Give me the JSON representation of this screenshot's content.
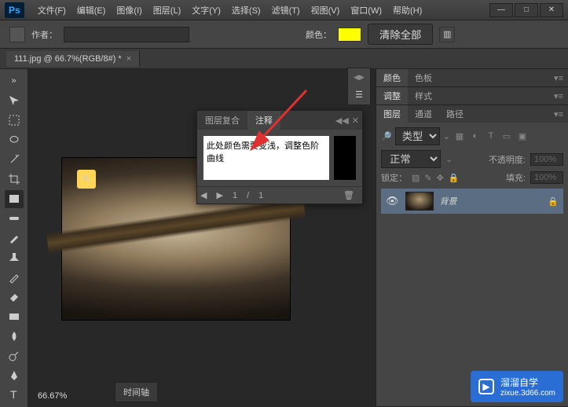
{
  "menubar": {
    "items": [
      "文件(F)",
      "编辑(E)",
      "图像(I)",
      "图层(L)",
      "文字(Y)",
      "选择(S)",
      "滤镜(T)",
      "视图(V)",
      "窗口(W)",
      "帮助(H)"
    ]
  },
  "window_controls": {
    "min": "—",
    "max": "□",
    "close": "✕"
  },
  "options": {
    "author_label": "作者：",
    "author_value": "",
    "color_label": "颜色：",
    "color_value": "#ffff00",
    "clear_all": "清除全部"
  },
  "doc_tab": {
    "title": "111.jpg @ 66.7%(RGB/8#) *"
  },
  "notes_panel": {
    "tabs": [
      "图层复合",
      "注释"
    ],
    "text": "此处颜色需要变浅，调整色阶曲线",
    "page_current": "1",
    "page_sep": "/",
    "page_total": "1"
  },
  "zoom": "66.67%",
  "timeline": "时间轴",
  "right": {
    "color_tabs": [
      "颜色",
      "色板"
    ],
    "adjust_tabs": [
      "调整",
      "样式"
    ],
    "layer_tabs": [
      "图层",
      "通道",
      "路径"
    ],
    "filter_label": "类型",
    "blend_mode": "正常",
    "opacity_label": "不透明度:",
    "opacity_value": "100%",
    "lock_label": "锁定：",
    "fill_label": "填充:",
    "fill_value": "100%",
    "layer_name": "背景"
  },
  "watermark": {
    "brand": "溜溜自学",
    "url": "zixue.3d66.com"
  }
}
